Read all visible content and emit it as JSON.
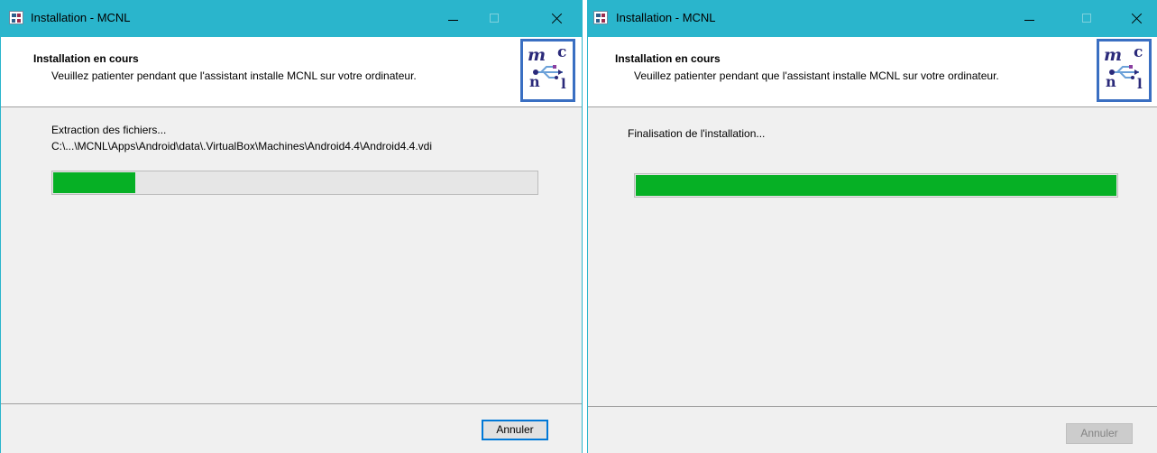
{
  "windows": [
    {
      "title": "Installation - MCNL",
      "header_title": "Installation en cours",
      "header_subtitle": "Veuillez patienter pendant que l'assistant installe MCNL sur votre ordinateur.",
      "status_line1": "Extraction des fichiers...",
      "status_line2": "C:\\...\\MCNL\\Apps\\Android\\data\\.VirtualBox\\Machines\\Android4.4\\Android4.4.vdi",
      "progress_percent": 17,
      "cancel_label": "Annuler",
      "cancel_enabled": true
    },
    {
      "title": "Installation - MCNL",
      "header_title": "Installation en cours",
      "header_subtitle": "Veuillez patienter pendant que l'assistant installe MCNL sur votre ordinateur.",
      "status_line1": "Finalisation de l'installation...",
      "progress_percent": 100,
      "cancel_label": "Annuler",
      "cancel_enabled": false
    }
  ],
  "logo": {
    "letters": [
      "m",
      "c",
      "n",
      "l"
    ],
    "icon": "usb-icon"
  },
  "colors": {
    "titlebar": "#2ab5cc",
    "progress_fill": "#06b025",
    "logo_border": "#3a6fc2",
    "focus_border": "#0078d7"
  }
}
